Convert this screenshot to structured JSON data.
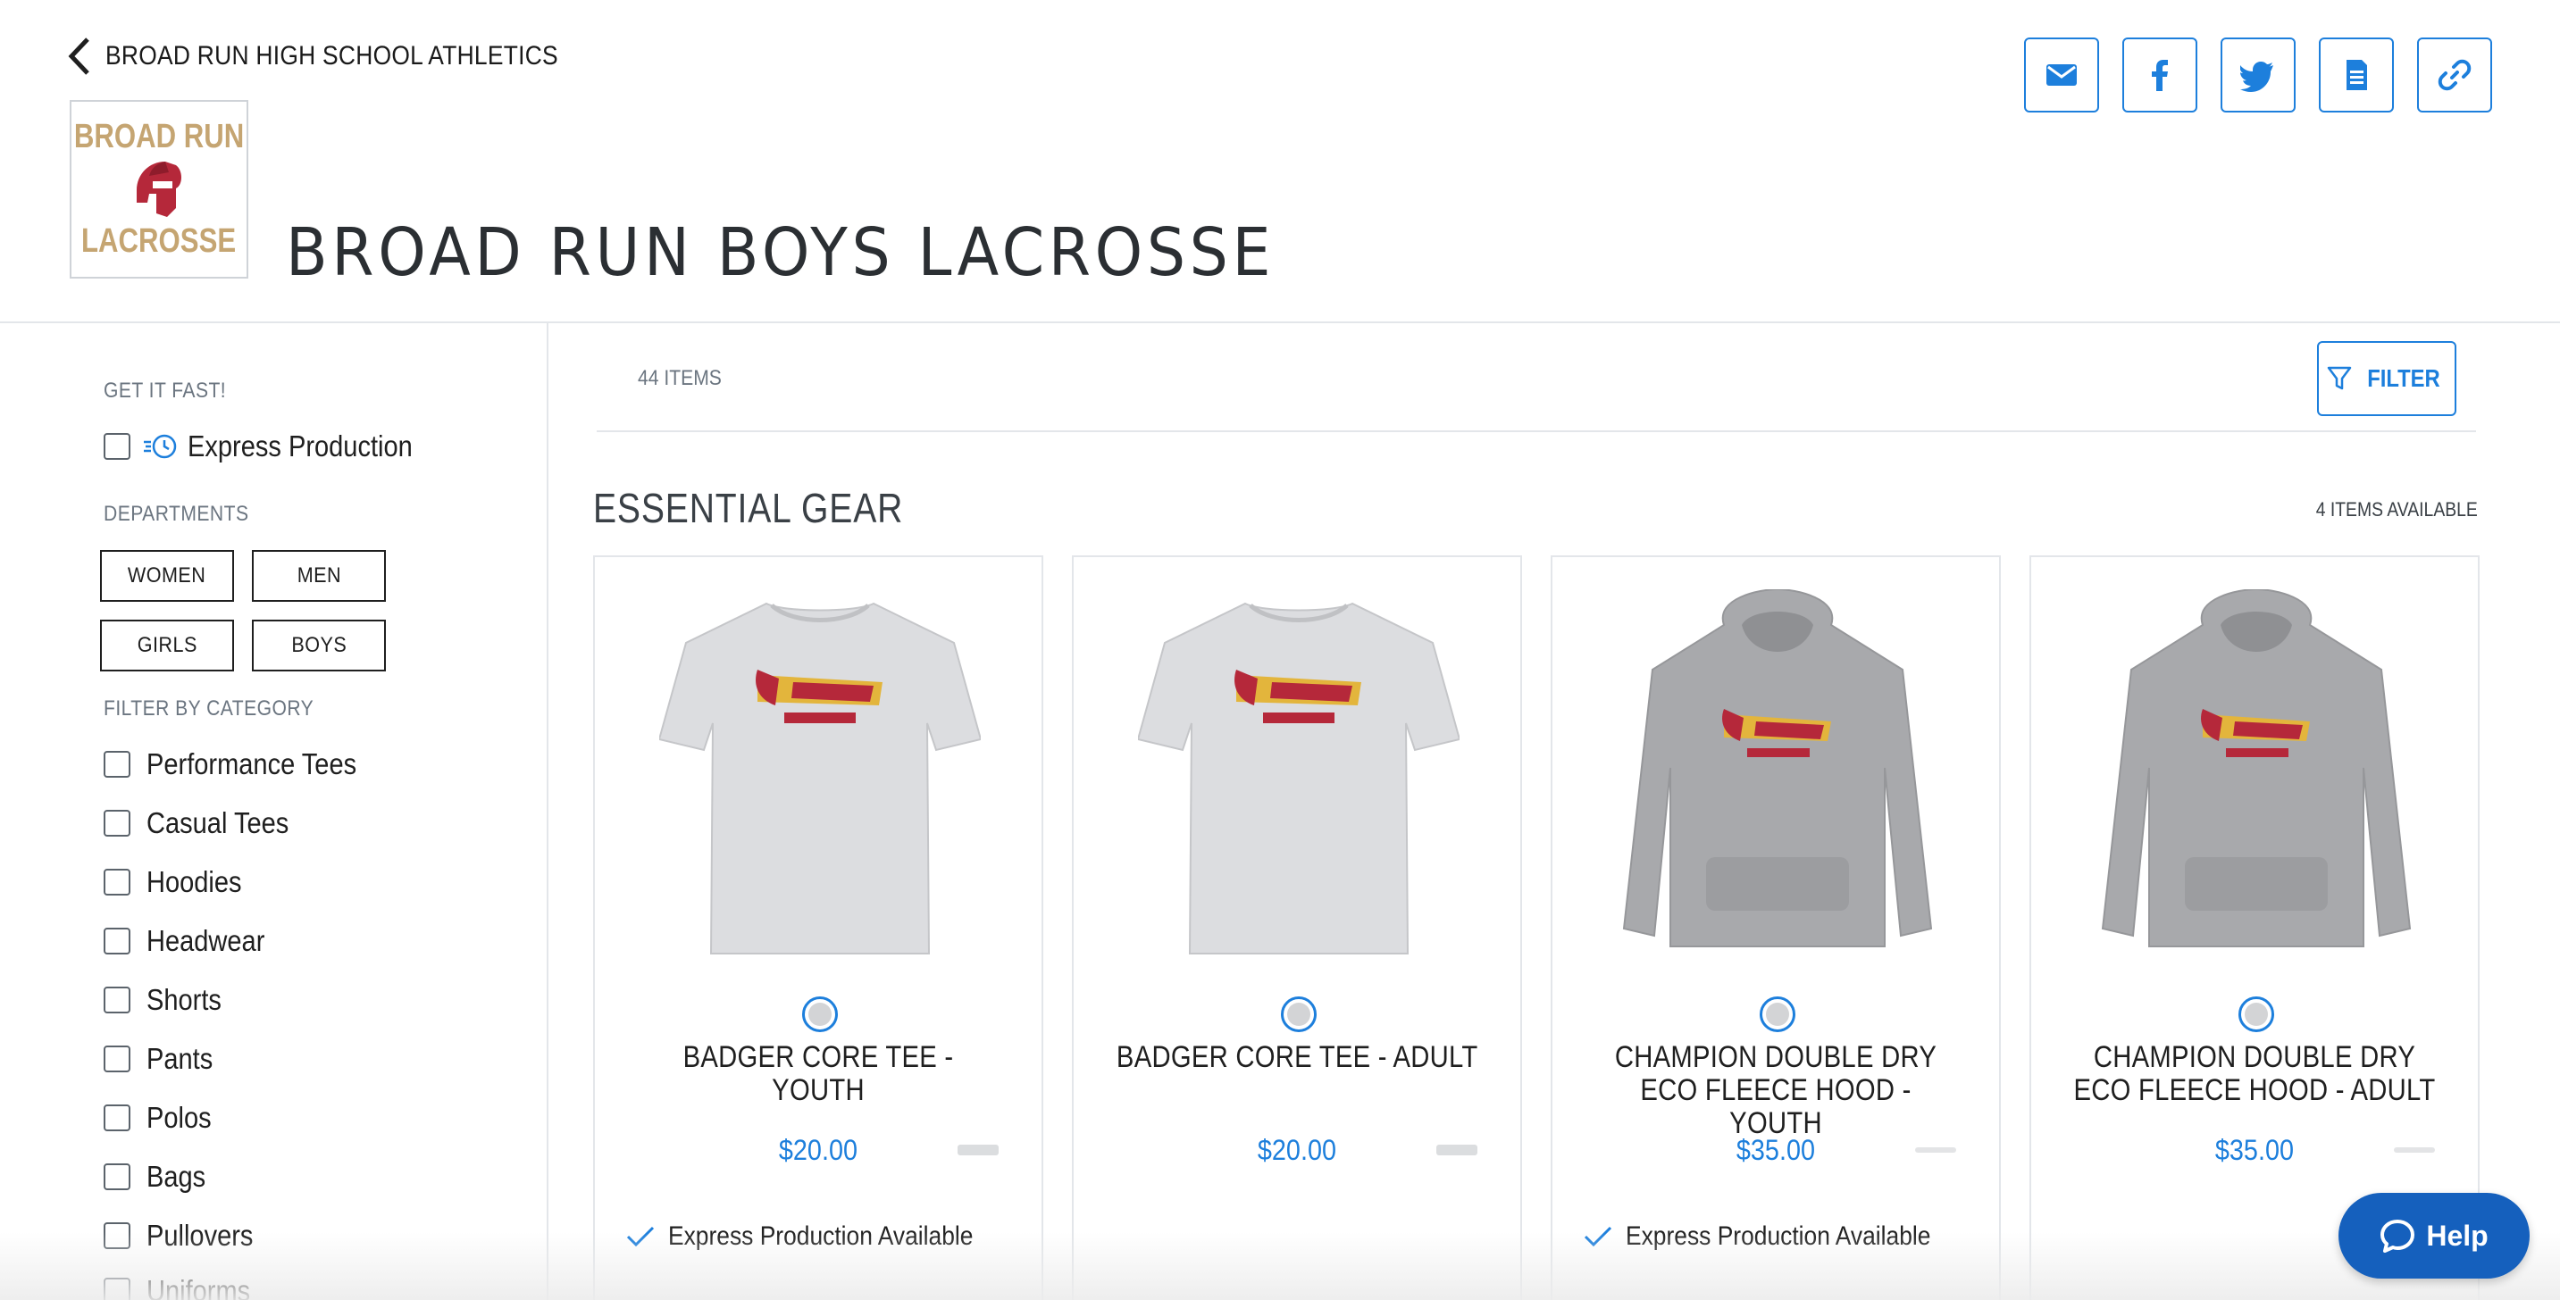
{
  "header": {
    "back_label": "BROAD RUN HIGH SCHOOL ATHLETICS",
    "logo_top": "BROAD RUN",
    "logo_bottom": "LACROSSE",
    "title": "BROAD RUN BOYS LACROSSE",
    "share_icons": [
      "email-icon",
      "facebook-icon",
      "twitter-icon",
      "document-icon",
      "link-icon"
    ]
  },
  "sidebar": {
    "get_it_fast_heading": "GET IT FAST!",
    "express_label": "Express Production",
    "departments_heading": "DEPARTMENTS",
    "departments": [
      "WOMEN",
      "MEN",
      "GIRLS",
      "BOYS"
    ],
    "category_heading": "FILTER BY CATEGORY",
    "categories": [
      "Performance Tees",
      "Casual Tees",
      "Hoodies",
      "Headwear",
      "Shorts",
      "Pants",
      "Polos",
      "Bags",
      "Pullovers",
      "Uniforms"
    ]
  },
  "main": {
    "items_count": "44 ITEMS",
    "filter_label": "FILTER",
    "section_title": "ESSENTIAL GEAR",
    "section_count": "4 ITEMS AVAILABLE",
    "products": [
      {
        "name": "BADGER CORE TEE - YOUTH",
        "price": "$20.00",
        "express": "Express Production Available",
        "kind": "tee"
      },
      {
        "name": "BADGER CORE TEE - ADULT",
        "price": "$20.00",
        "express": "",
        "kind": "tee"
      },
      {
        "name": "CHAMPION DOUBLE DRY ECO FLEECE HOOD - YOUTH",
        "price": "$35.00",
        "express": "Express Production Available",
        "kind": "hood"
      },
      {
        "name": "CHAMPION DOUBLE DRY ECO FLEECE HOOD - ADULT",
        "price": "$35.00",
        "express": "",
        "kind": "hood"
      }
    ]
  },
  "help": {
    "label": "Help"
  },
  "colors": {
    "accent": "#1d7fdc",
    "help_bg": "#1560bd",
    "logo_gold": "#c5a572",
    "logo_red": "#b5283a"
  }
}
